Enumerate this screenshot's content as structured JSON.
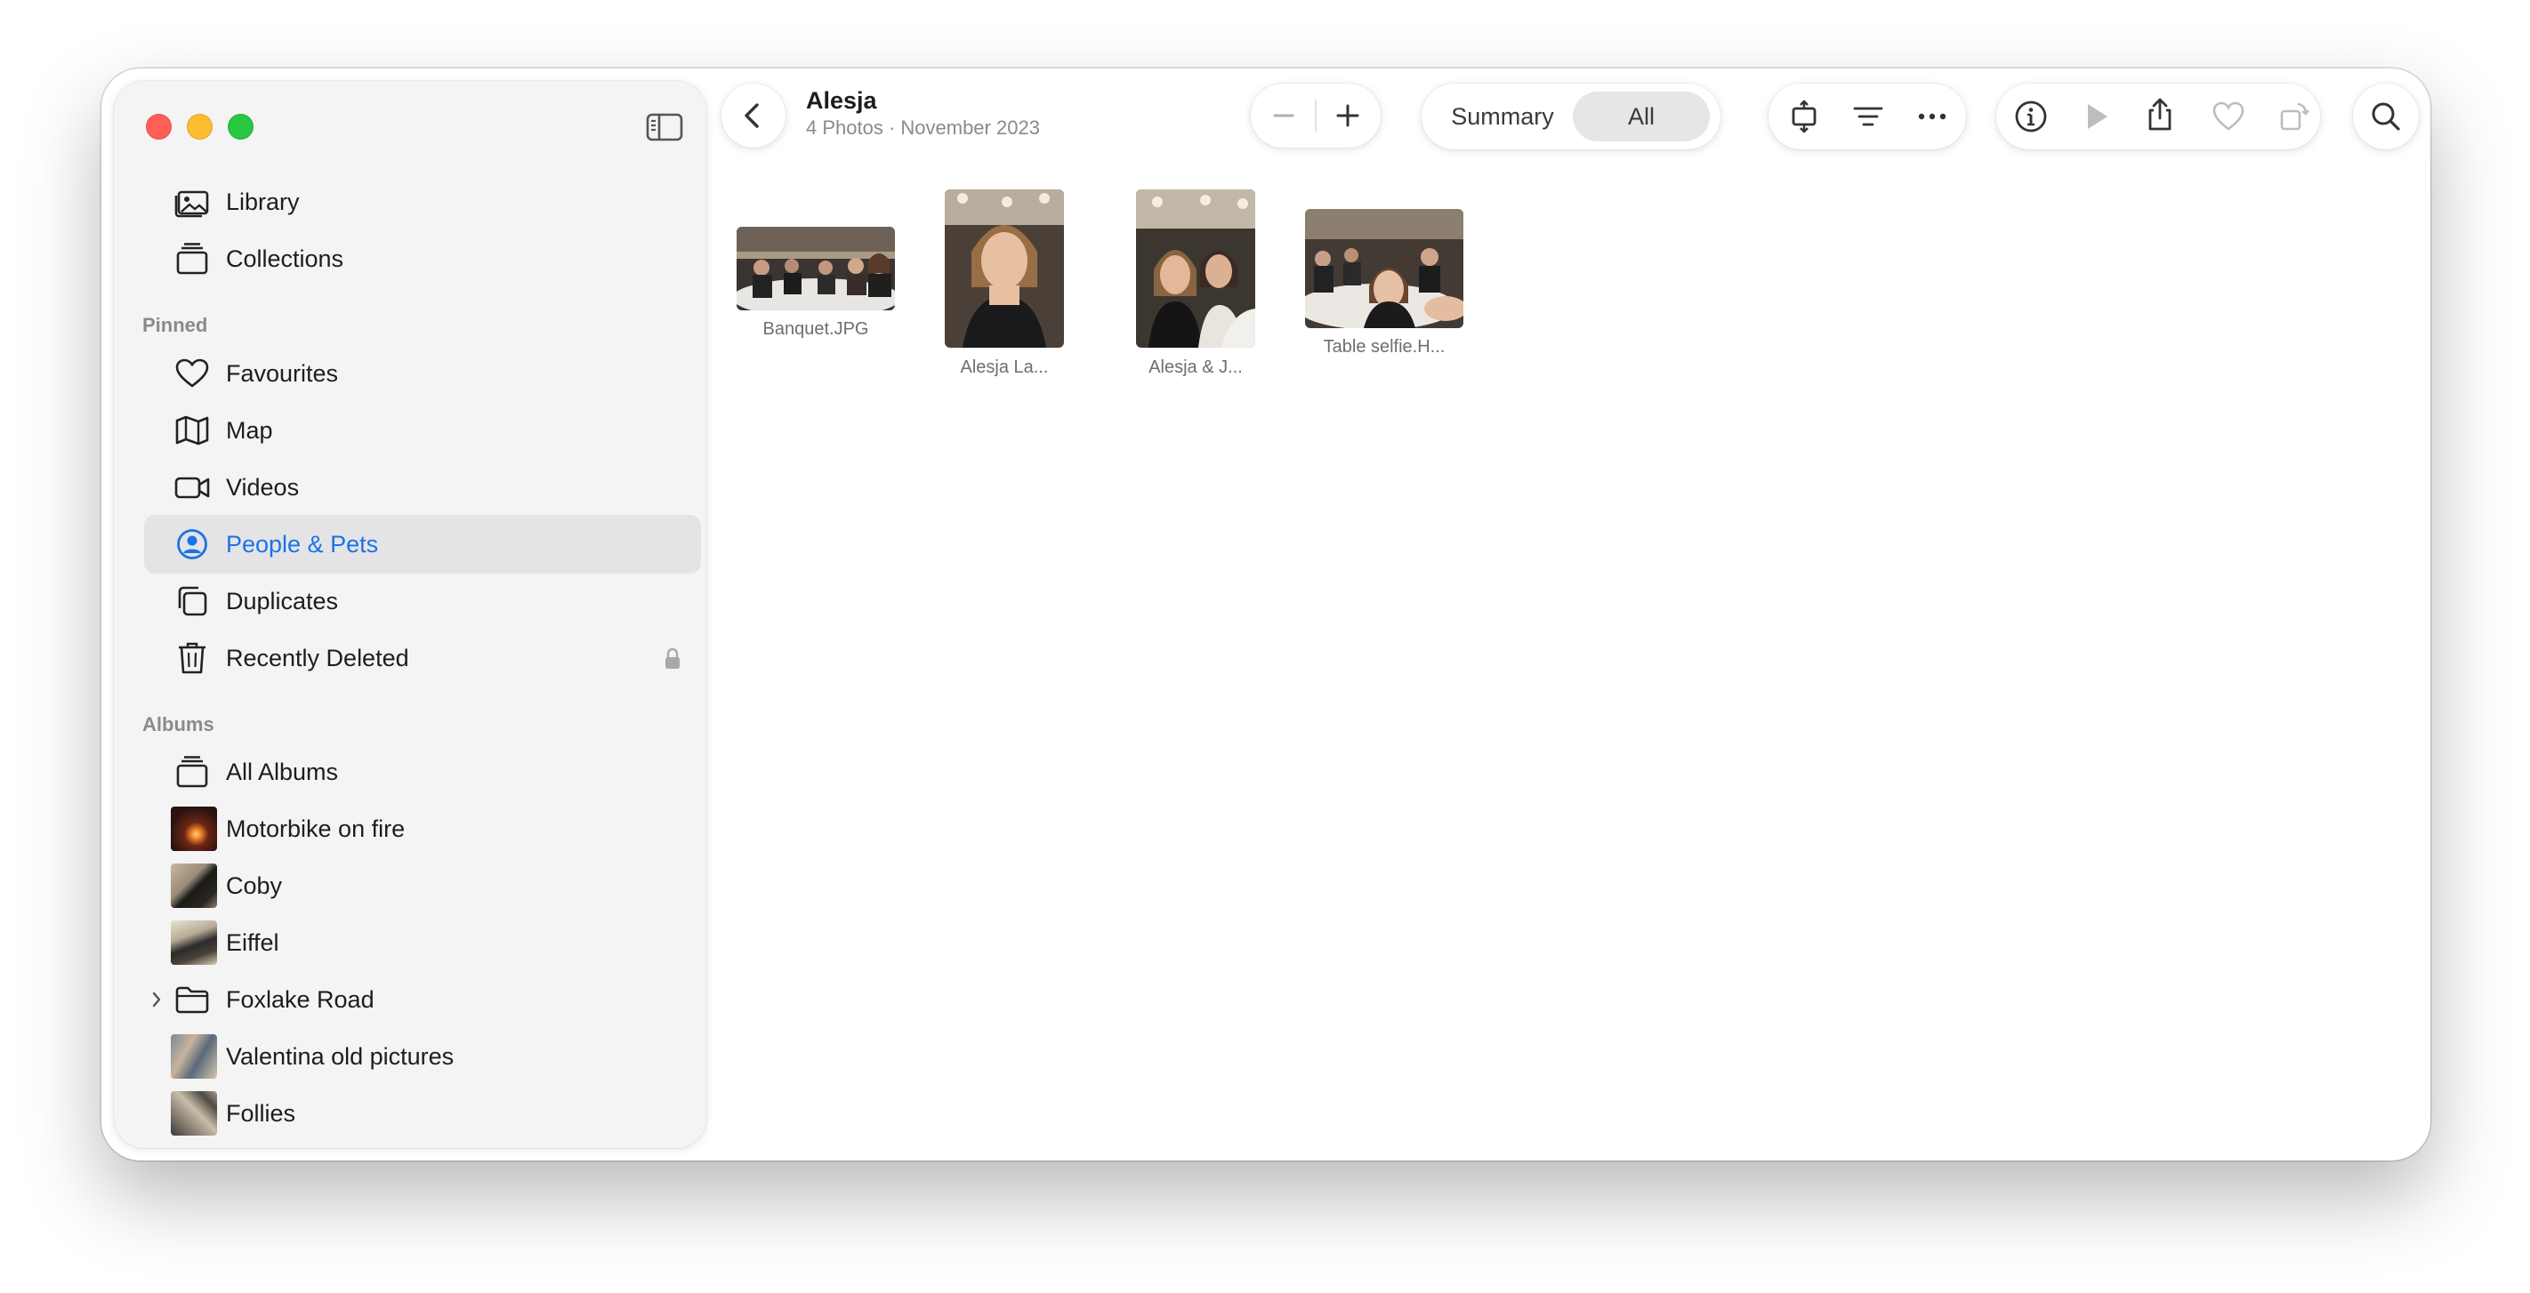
{
  "window": {
    "traffic_lights": [
      "close",
      "minimize",
      "zoom"
    ]
  },
  "sidebar": {
    "top_items": [
      {
        "label": "Library",
        "icon": "photo-library-icon"
      },
      {
        "label": "Collections",
        "icon": "collections-stack-icon"
      }
    ],
    "pinned_label": "Pinned",
    "pinned_items": [
      {
        "label": "Favourites",
        "icon": "heart-icon"
      },
      {
        "label": "Map",
        "icon": "map-icon"
      },
      {
        "label": "Videos",
        "icon": "video-camera-icon"
      },
      {
        "label": "People & Pets",
        "icon": "person-circle-icon",
        "selected": true
      },
      {
        "label": "Duplicates",
        "icon": "duplicate-squares-icon"
      },
      {
        "label": "Recently Deleted",
        "icon": "trash-icon",
        "locked": true
      }
    ],
    "albums_label": "Albums",
    "album_items": [
      {
        "label": "All Albums",
        "icon": "albums-stack-icon"
      },
      {
        "label": "Motorbike on fire",
        "icon": "album-thumbnail"
      },
      {
        "label": "Coby",
        "icon": "album-thumbnail"
      },
      {
        "label": "Eiffel",
        "icon": "album-thumbnail"
      },
      {
        "label": "Foxlake Road",
        "icon": "folder-icon",
        "disclosure": true
      },
      {
        "label": "Valentina old pictures",
        "icon": "album-thumbnail"
      },
      {
        "label": "Follies",
        "icon": "album-thumbnail"
      }
    ]
  },
  "header": {
    "title": "Alesja",
    "subtitle": "4 Photos · November 2023"
  },
  "toolbar": {
    "zoom_out": "zoom-out-icon",
    "zoom_in": "zoom-in-icon",
    "segments": [
      {
        "label": "Summary",
        "active": false
      },
      {
        "label": "All",
        "active": true
      }
    ],
    "icons": [
      "aspect-ratio-icon",
      "filter-icon",
      "more-icon",
      "info-icon",
      "play-icon",
      "share-icon",
      "favourite-icon",
      "rotate-icon",
      "search-icon"
    ]
  },
  "photos": [
    {
      "caption": "Banquet.JPG"
    },
    {
      "caption": "Alesja La..."
    },
    {
      "caption": "Alesja & J..."
    },
    {
      "caption": "Table selfie.H..."
    }
  ],
  "colors": {
    "accent": "#1a73e8",
    "sidebar_bg": "#f4f4f4",
    "selected_bg": "#e4e4e6",
    "secondary_text": "#8a8a8e"
  }
}
